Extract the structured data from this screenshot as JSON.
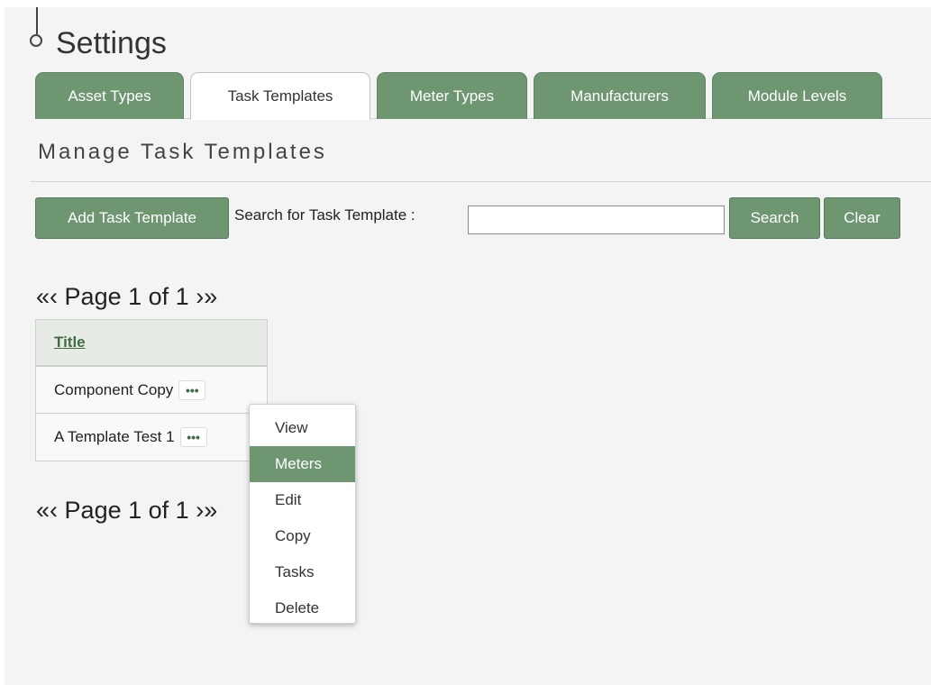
{
  "header": {
    "title": "Settings"
  },
  "tabs": [
    {
      "label": "Asset Types",
      "active": false
    },
    {
      "label": "Task Templates",
      "active": true
    },
    {
      "label": "Meter Types",
      "active": false
    },
    {
      "label": "Manufacturers",
      "active": false
    },
    {
      "label": "Module Levels",
      "active": false
    }
  ],
  "section": {
    "title": "Manage Task Templates"
  },
  "toolbar": {
    "add_label": "Add Task Template",
    "search_label": "Search for Task Template :",
    "search_value": "",
    "search_button": "Search",
    "clear_button": "Clear"
  },
  "pager": {
    "first": "«",
    "prev": "‹",
    "text": "Page 1 of 1",
    "next": "›",
    "last": "»"
  },
  "table": {
    "header": "Title",
    "rows": [
      {
        "title": "Component Copy",
        "menu": "•••"
      },
      {
        "title": "A Template Test 1",
        "menu": "•••"
      }
    ]
  },
  "context_menu": {
    "items": [
      "View",
      "Meters",
      "Edit",
      "Copy",
      "Tasks",
      "Delete"
    ],
    "highlighted": "Meters"
  },
  "colors": {
    "accent": "#6e9671",
    "accent_dark": "#3f6d43",
    "background": "#f4f4f4"
  }
}
